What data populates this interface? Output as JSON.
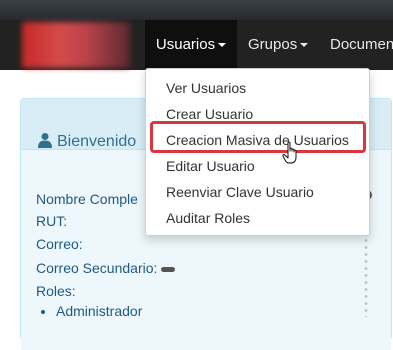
{
  "navbar": {
    "items": [
      {
        "label": "Usuarios",
        "caret": true,
        "active": true
      },
      {
        "label": "Grupos",
        "caret": true,
        "active": false
      },
      {
        "label": "Documen",
        "caret": false,
        "active": false
      }
    ]
  },
  "dropdown": {
    "items": [
      {
        "label": "Ver Usuarios"
      },
      {
        "label": "Crear Usuario"
      },
      {
        "label": "Creacion Masiva de Usuarios",
        "highlighted": true
      },
      {
        "label": "Editar Usuario"
      },
      {
        "label": "Reenviar Clave Usuario"
      },
      {
        "label": "Auditar Roles"
      }
    ]
  },
  "panel": {
    "title": "Bienvenido",
    "fields": {
      "nombre": "Nombre Comple",
      "rut": "RUT:",
      "correo": "Correo:",
      "correo_secundario": "Correo Secundario:",
      "roles": "Roles:"
    },
    "roles": [
      "Administrador"
    ]
  },
  "colors": {
    "navbar_bg": "#222222",
    "panel_heading_bg": "#d9edf7",
    "highlight_border": "#d9363e",
    "link_text": "#1e5a84"
  },
  "icons": [
    "user-icon",
    "caret-down-icon",
    "hand-pointer-cursor-icon"
  ]
}
